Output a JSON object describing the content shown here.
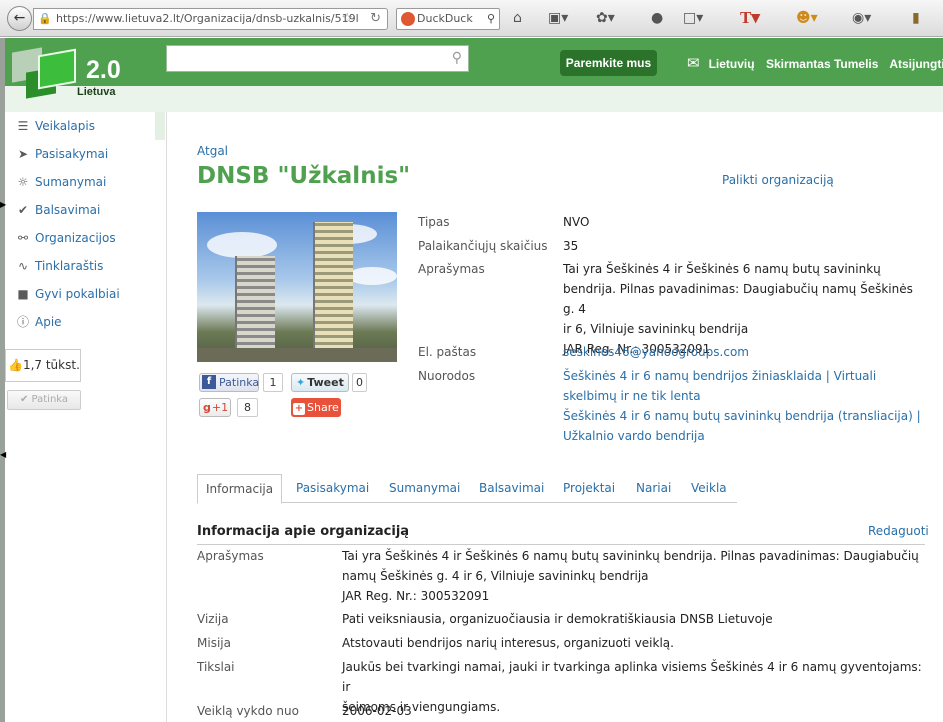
{
  "browser": {
    "url": "https://www.lietuva2.lt/Organizacija/dnsb-uzkalnis/519l",
    "search_placeholder": "DuckDuck"
  },
  "header": {
    "logo_version": "2.0",
    "logo_country": "Lietuva",
    "support_button": "Paremkite mus",
    "language": "Lietuvių",
    "user_name": "Skirmantas Tumelis",
    "logout": "Atsijungti"
  },
  "sidebar": {
    "items": [
      {
        "label": "Veikalapis",
        "icon": "list-icon"
      },
      {
        "label": "Pasisakymai",
        "icon": "megaphone-icon"
      },
      {
        "label": "Sumanymai",
        "icon": "lightbulb-icon"
      },
      {
        "label": "Balsavimai",
        "icon": "vote-check-icon"
      },
      {
        "label": "Organizacijos",
        "icon": "network-icon"
      },
      {
        "label": "Tinklaraštis",
        "icon": "rss-icon"
      },
      {
        "label": "Gyvi pokalbiai",
        "icon": "chat-bubble-icon"
      },
      {
        "label": "Apie",
        "icon": "info-icon"
      }
    ],
    "like_count": "1,7 tūkst.",
    "like_button": "Patinka"
  },
  "org": {
    "back_link": "Atgal",
    "title": "DNSB \"Užkalnis\"",
    "leave_link": "Palikti organizaciją",
    "fields": {
      "type_label": "Tipas",
      "type_value": "NVO",
      "supporters_label": "Palaikančiųjų skaičius",
      "supporters_value": "35",
      "description_label": "Aprašymas",
      "description_line1": "Tai yra Šeškinės 4 ir Šeškinės 6 namų butų savininkų",
      "description_line2": "bendrija. Pilnas pavadinimas: Daugiabučių namų Šeškinės g. 4",
      "description_line3": "ir 6, Vilniuje savininkų bendrija",
      "description_line4": "JAR Reg. Nr.: 300532091",
      "email_label": "El. paštas",
      "email_value": "seskines46@yahoogroups.com",
      "links_label": "Nuorodos",
      "link1_line1": "Šeškinės 4 ir 6 namų bendrijos žiniasklaida | Virtuali",
      "link1_line2": "skelbimų ir ne tik lenta",
      "link2_line1": "Šeškinės 4 ir 6 namų butų savininkų bendrija (transliacija) |",
      "link2_line2": "Užkalnio vardo bendrija"
    },
    "social": {
      "fb_label": "Patinka",
      "fb_count": "1",
      "tweet_label": "Tweet",
      "tweet_count": "0",
      "gplus_label": "+1",
      "gplus_count": "8",
      "share_label": "Share"
    }
  },
  "tabs": [
    "Informacija",
    "Pasisakymai",
    "Sumanymai",
    "Balsavimai",
    "Projektai",
    "Nariai",
    "Veikla"
  ],
  "info": {
    "heading": "Informacija apie organizaciją",
    "edit_link": "Redaguoti",
    "description_label": "Aprašymas",
    "description_line1": "Tai yra Šeškinės 4 ir Šeškinės 6 namų butų savininkų bendrija. Pilnas pavadinimas: Daugiabučių",
    "description_line2": "namų Šeškinės g. 4 ir 6, Vilniuje savininkų bendrija",
    "description_line3": "JAR Reg. Nr.: 300532091",
    "vision_label": "Vizija",
    "vision_value": "Pati veiksniausia, organizuočiausia ir demokratiškiausia DNSB Lietuvoje",
    "mission_label": "Misija",
    "mission_value": "Atstovauti bendrijos narių interesus, organizuoti veiklą.",
    "goals_label": "Tikslai",
    "goals_line1": "Jaukūs bei tvarkingi namai, jauki ir tvarkinga aplinka visiems Šeškinės 4 ir 6 namų gyventojams: ir",
    "goals_line2": "šeimoms ir viengungiams.",
    "since_label": "Veiklą vykdo nuo",
    "since_value": "2006-02-03"
  },
  "colors": {
    "brand_green": "#4fa14f",
    "link_blue": "#2a6fa8",
    "support_button": "#2b722b"
  }
}
